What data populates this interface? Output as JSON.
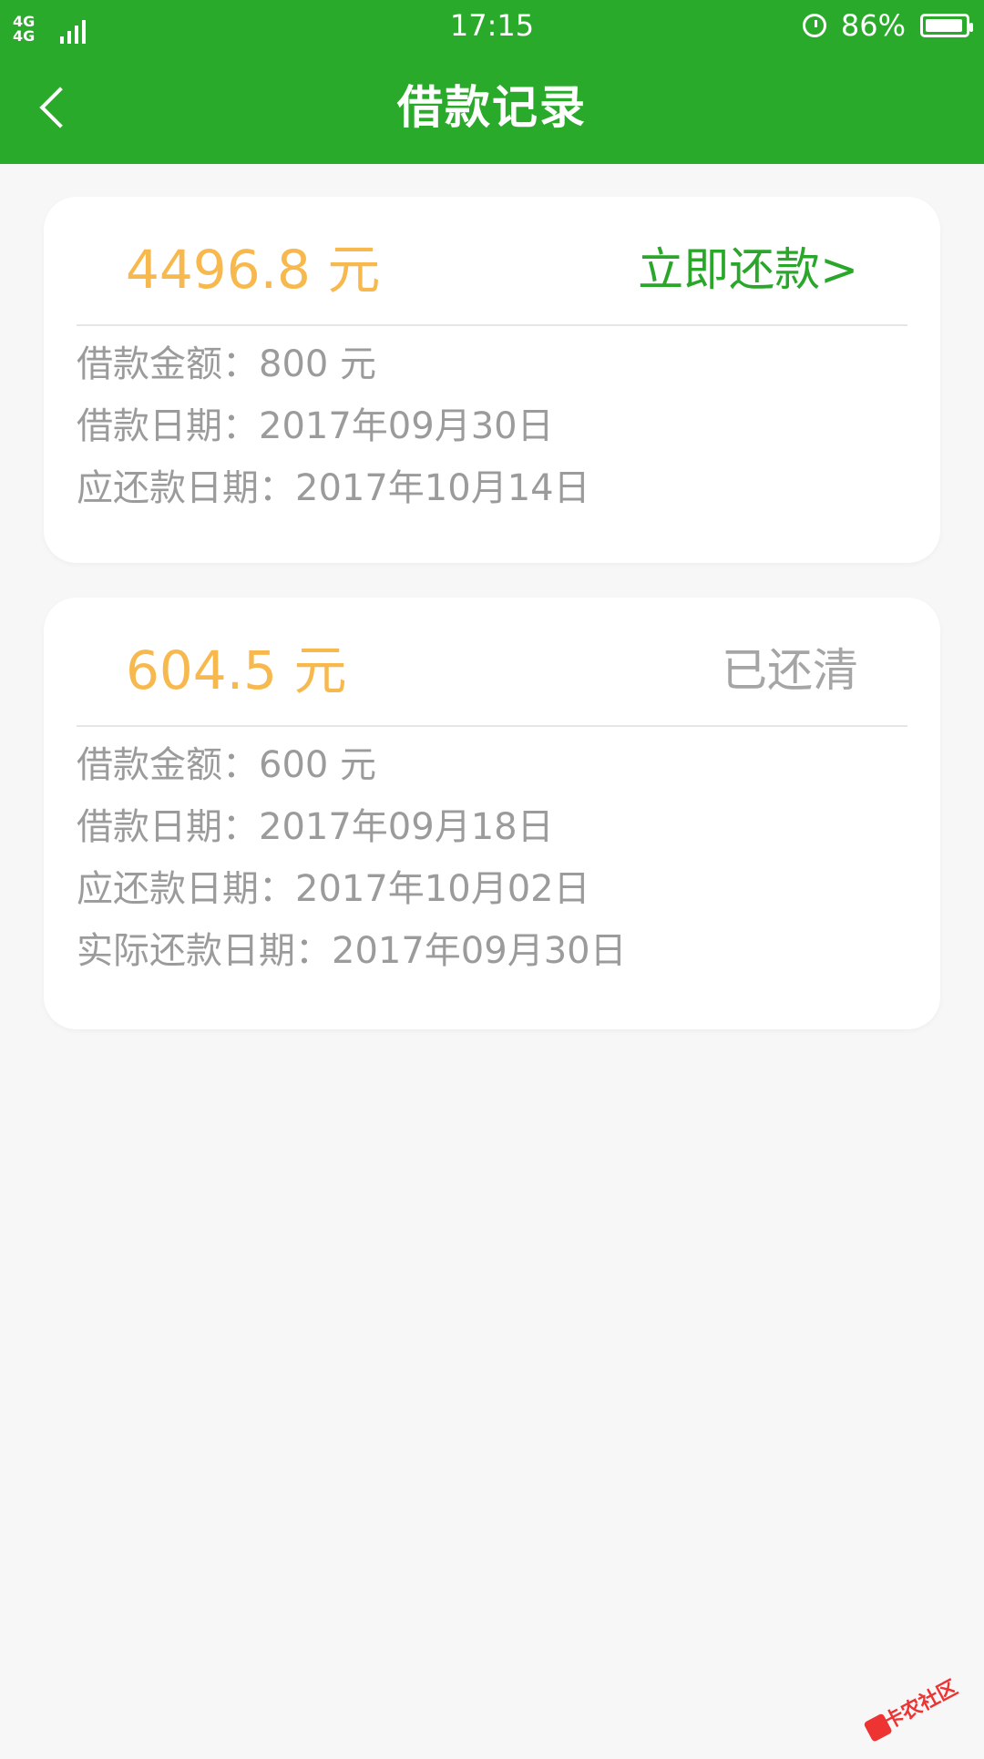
{
  "status_bar": {
    "network": "4G 4G",
    "time": "17:15",
    "battery_level": "86%"
  },
  "app_bar": {
    "title": "借款记录"
  },
  "cards": [
    {
      "amount": "4496.8 元",
      "action": "立即还款>",
      "details": [
        "借款金额：800 元",
        "借款日期：2017年09月30日",
        "应还款日期：2017年10月14日"
      ]
    },
    {
      "amount": "604.5 元",
      "action": "已还清",
      "details": [
        "借款金额：600 元",
        "借款日期：2017年09月18日",
        "应还款日期：2017年10月02日",
        "实际还款日期：2017年09月30日"
      ]
    }
  ],
  "watermark": {
    "text": "卡农社区"
  },
  "colors": {
    "primary": "#2aaa2a",
    "amount": "#f7b94d",
    "muted": "#a5a5a5",
    "background": "#f7f7f7"
  }
}
